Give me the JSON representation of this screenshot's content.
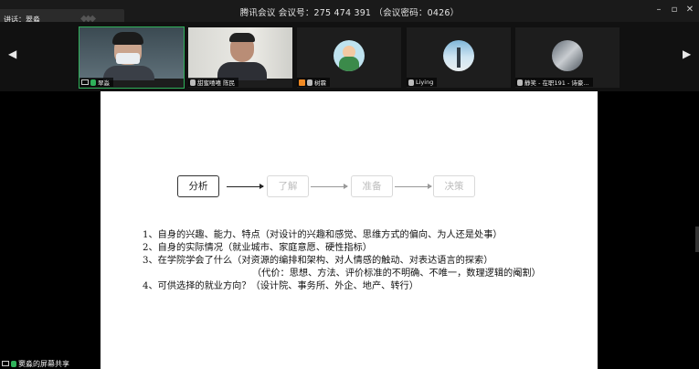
{
  "window": {
    "title": "腾讯会议 会议号：275 474 391 （会议密码：0426）",
    "controls": {
      "minimize": "–",
      "maximize": "▫",
      "close": "✕"
    }
  },
  "speaking": {
    "label": "讲话：翠淼"
  },
  "participants": [
    {
      "name": "翠淼",
      "mic": "green",
      "active": true
    },
    {
      "name": "甜蜜嘻嘻 陈民"
    },
    {
      "name": "树霖"
    },
    {
      "name": "Liying"
    },
    {
      "name": "静笑 - 在职191 - 诗豪..."
    }
  ],
  "slide": {
    "flow": [
      "分析",
      "了解",
      "准备",
      "决策"
    ],
    "lines": [
      "1、自身的兴趣、能力、特点（对设计的兴趣和感觉、思维方式的偏向、为人还是处事）",
      "2、自身的实际情况（就业城市、家庭意愿、硬性指标）",
      "3、在学院学会了什么（对资源的编排和架构、对人情感的触动、对表达语言的探索）",
      "（代价：思想、方法、评价标准的不明确、不唯一，数理逻辑的阉割）",
      "4、可供选择的就业方向？（设计院、事务所、外企、地产、转行）"
    ]
  },
  "sharing": {
    "label": "窦淼的屏幕共享"
  },
  "colors": {
    "active_tile": "#2fb15a",
    "background": "#000000",
    "slide": "#ffffff"
  },
  "icons": [
    "left-arrow-icon",
    "right-arrow-icon",
    "microphone-icon",
    "screen-share-icon"
  ]
}
